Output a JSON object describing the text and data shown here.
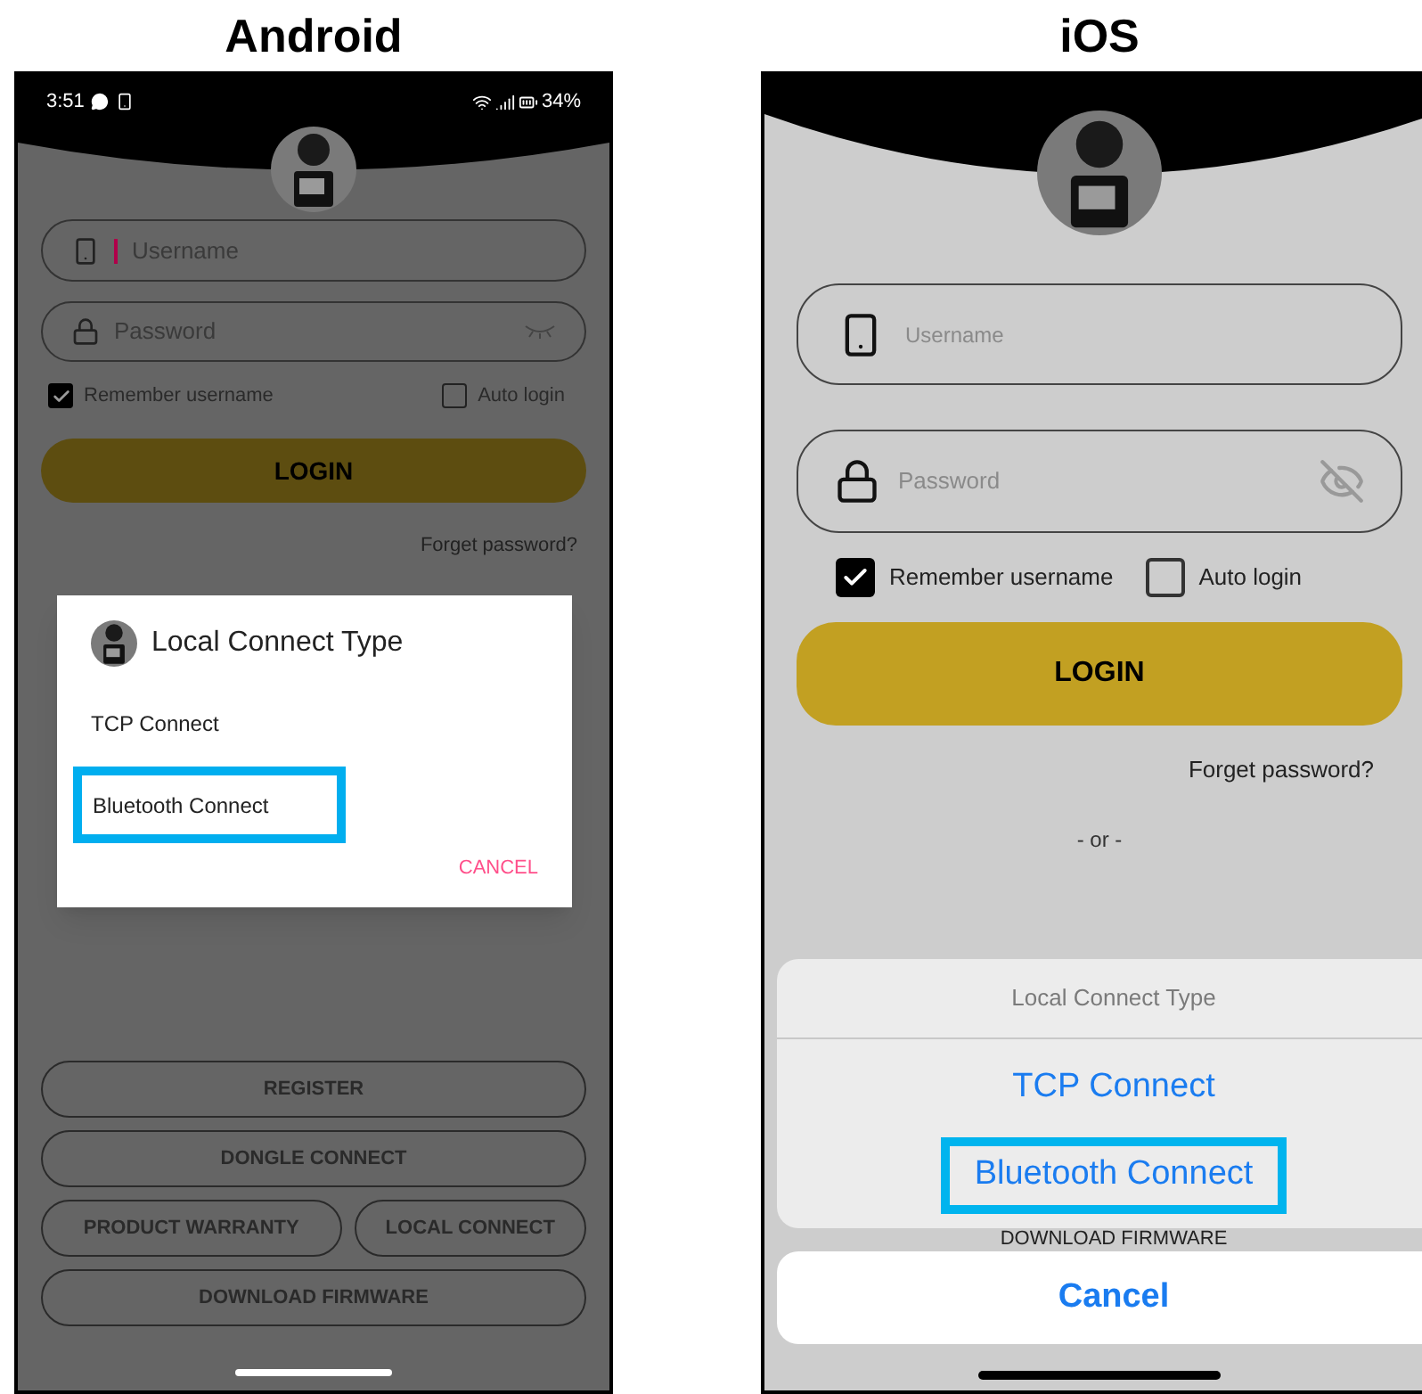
{
  "android": {
    "heading": "Android",
    "status_bar": {
      "time": "3:51",
      "battery": "34%"
    },
    "username": {
      "placeholder": "Username",
      "focused": true
    },
    "password": {
      "placeholder": "Password"
    },
    "checkboxes": [
      {
        "label": "Remember username",
        "checked": true
      },
      {
        "label": "Auto login",
        "checked": false
      }
    ],
    "login": "LOGIN",
    "forgot": "Forget password?",
    "dialog": {
      "title": "Local Connect Type",
      "options": [
        {
          "label": "TCP Connect",
          "highlighted": false
        },
        {
          "label": "Bluetooth Connect",
          "highlighted": true
        }
      ],
      "cancel": "CANCEL"
    },
    "button_rows": [
      {
        "buttons": [
          "REGISTER"
        ]
      },
      {
        "buttons": [
          "DONGLE CONNECT"
        ]
      },
      {
        "buttons": [
          "PRODUCT WARRANTY",
          "LOCAL CONNECT"
        ]
      },
      {
        "buttons": [
          "DOWNLOAD FIRMWARE"
        ]
      }
    ]
  },
  "ios": {
    "heading": "iOS",
    "username": {
      "placeholder": "Username"
    },
    "password": {
      "placeholder": "Password"
    },
    "checkboxes": [
      {
        "label": "Remember username",
        "checked": true
      },
      {
        "label": "Auto login",
        "checked": false
      }
    ],
    "login": "LOGIN",
    "forgot": "Forget password?",
    "separator": "- or -",
    "behind_button": "DOWNLOAD FIRMWARE",
    "action_sheet": {
      "title": "Local Connect Type",
      "options": [
        {
          "label": "TCP Connect",
          "highlighted": false
        },
        {
          "label": "Bluetooth Connect",
          "highlighted": true
        }
      ],
      "cancel": "Cancel"
    }
  }
}
